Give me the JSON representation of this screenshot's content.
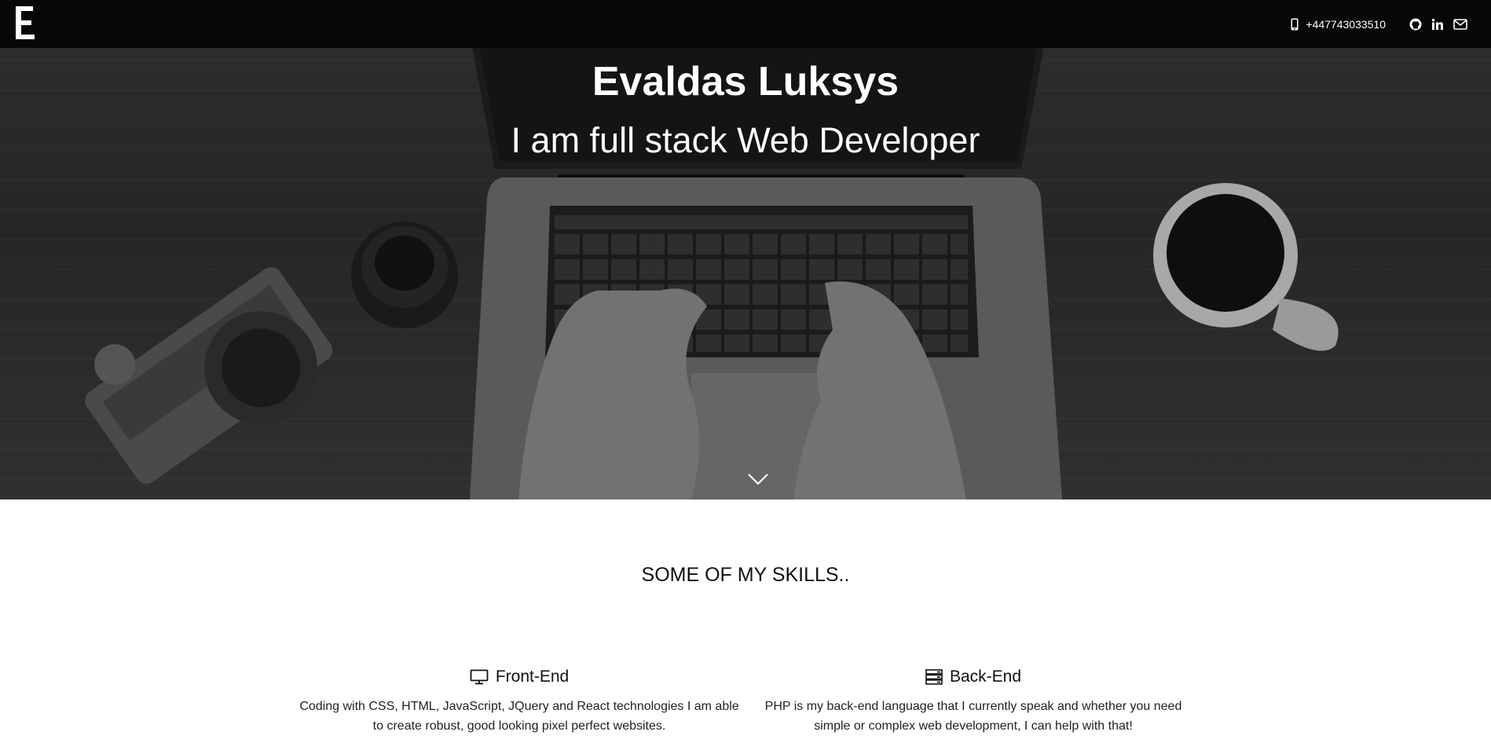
{
  "nav": {
    "logo_letter": "E",
    "phone": "+447743033510",
    "icons": [
      "phone-icon",
      "github-icon",
      "linkedin-icon",
      "envelope-icon"
    ]
  },
  "hero": {
    "title": "Evaldas Luksys",
    "subtitle": "I am full stack Web Developer",
    "scroll_icon": "chevron-down-icon"
  },
  "skills": {
    "title": "SOME OF MY SKILLS..",
    "items": [
      {
        "icon": "monitor-icon",
        "title": "Front-End",
        "text": "Coding with CSS, HTML, JavaScript, JQuery and React technologies I am able to create robust, good looking pixel perfect websites."
      },
      {
        "icon": "server-icon",
        "title": "Back-End",
        "text": "PHP is my back-end language that I currently speak and whether you need simple or complex web development, I can help with that!"
      }
    ]
  },
  "colors": {
    "navbar": "#080808",
    "hero_overlay": "#262626",
    "text_light": "#ffffff",
    "text_dark": "#111111"
  }
}
